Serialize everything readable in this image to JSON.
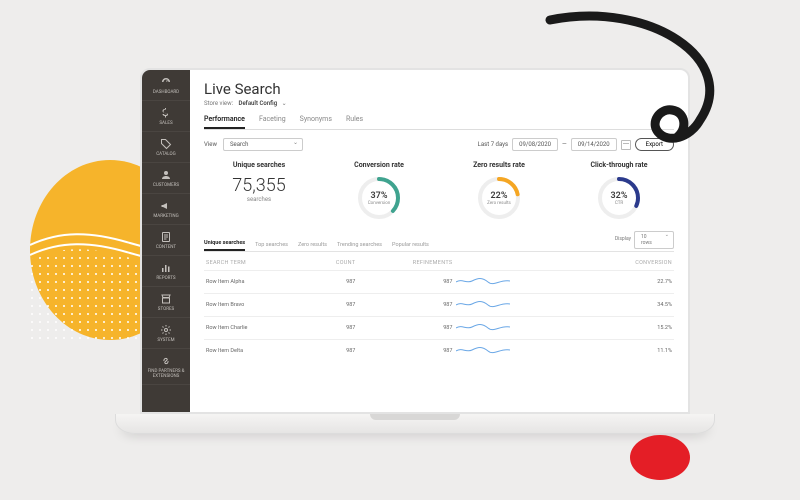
{
  "page": {
    "title": "Live Search",
    "storeview_label": "Store view:",
    "storeview_value": "Default Config"
  },
  "tabs": [
    {
      "label": "Performance",
      "active": true
    },
    {
      "label": "Faceting",
      "active": false
    },
    {
      "label": "Synonyms",
      "active": false
    },
    {
      "label": "Rules",
      "active": false
    }
  ],
  "controls": {
    "view_label": "View",
    "view_value": "Search",
    "range_label": "Last 7 days",
    "date_from": "09/08/2020",
    "date_to": "09/14/2020",
    "export": "Export"
  },
  "cards": {
    "unique": {
      "title": "Unique searches",
      "value": "75,355",
      "sub": "searches"
    },
    "conversion": {
      "title": "Conversion rate",
      "value": "37%",
      "sub": "Conversion",
      "pct": 37,
      "color": "#3fa38f"
    },
    "zero": {
      "title": "Zero results rate",
      "value": "22%",
      "sub": "Zero results",
      "pct": 22,
      "color": "#f5a623"
    },
    "ctr": {
      "title": "Click-through rate",
      "value": "32%",
      "sub": "CTR",
      "pct": 32,
      "color": "#2b3a8c"
    }
  },
  "inner_tabs": [
    {
      "label": "Unique searches",
      "active": true
    },
    {
      "label": "Top searches"
    },
    {
      "label": "Zero results"
    },
    {
      "label": "Trending searches"
    },
    {
      "label": "Popular results"
    }
  ],
  "display": {
    "label": "Display",
    "value": "10 rows"
  },
  "table": {
    "headers": {
      "term": "SEARCH TERM",
      "count": "COUNT",
      "ref": "REFINEMENTS",
      "conv": "CONVERSION"
    },
    "rows": [
      {
        "term": "Row Item Alpha",
        "count": "987",
        "ref": "987",
        "conv": "22.7%"
      },
      {
        "term": "Row Item Bravo",
        "count": "987",
        "ref": "987",
        "conv": "34.5%"
      },
      {
        "term": "Row Item Charlie",
        "count": "987",
        "ref": "987",
        "conv": "15.2%"
      },
      {
        "term": "Row Item Delta",
        "count": "987",
        "ref": "987",
        "conv": "11.1%"
      }
    ]
  },
  "sidebar": [
    {
      "label": "DASHBOARD",
      "icon": "gauge"
    },
    {
      "label": "SALES",
      "icon": "dollar"
    },
    {
      "label": "CATALOG",
      "icon": "tag"
    },
    {
      "label": "CUSTOMERS",
      "icon": "user"
    },
    {
      "label": "MARKETING",
      "icon": "megaphone"
    },
    {
      "label": "CONTENT",
      "icon": "doc"
    },
    {
      "label": "REPORTS",
      "icon": "bars"
    },
    {
      "label": "STORES",
      "icon": "store"
    },
    {
      "label": "SYSTEM",
      "icon": "gear"
    },
    {
      "label": "FIND PARTNERS & EXTENSIONS",
      "icon": "link"
    }
  ]
}
